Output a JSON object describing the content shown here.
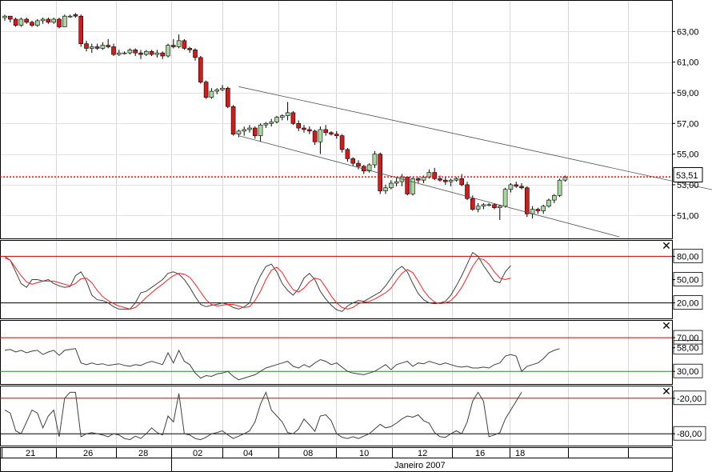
{
  "chart_data": [
    {
      "type": "candlestick",
      "panel": "price",
      "ylim": [
        49.5,
        65.0
      ],
      "y_ticks": [
        "63,00",
        "61,00",
        "59,00",
        "57,00",
        "55,00",
        "53,00",
        "51,00"
      ],
      "y_tick_values": [
        63,
        61,
        59,
        57,
        55,
        53,
        51
      ],
      "last_price": 53.51,
      "last_price_label": "53,51",
      "candles": [
        [
          63.9,
          64.1,
          63.7,
          64.0
        ],
        [
          64.0,
          64.0,
          63.6,
          63.8
        ],
        [
          63.8,
          63.9,
          63.3,
          63.4
        ],
        [
          63.4,
          63.9,
          63.3,
          63.8
        ],
        [
          63.8,
          63.9,
          63.5,
          63.6
        ],
        [
          63.6,
          63.7,
          63.3,
          63.4
        ],
        [
          63.4,
          63.8,
          63.3,
          63.7
        ],
        [
          63.7,
          63.9,
          63.5,
          63.8
        ],
        [
          63.8,
          63.9,
          63.5,
          63.6
        ],
        [
          63.6,
          63.9,
          63.5,
          63.8
        ],
        [
          63.8,
          63.9,
          63.2,
          63.3
        ],
        [
          63.3,
          64.1,
          63.3,
          64.0
        ],
        [
          64.0,
          64.1,
          63.9,
          64.0
        ],
        [
          64.1,
          64.2,
          63.9,
          64.0
        ],
        [
          64.0,
          64.1,
          62.0,
          62.2
        ],
        [
          62.2,
          62.4,
          61.7,
          61.9
        ],
        [
          61.9,
          62.2,
          61.6,
          62.0
        ],
        [
          62.0,
          62.2,
          61.8,
          61.9
        ],
        [
          61.9,
          62.3,
          61.8,
          62.1
        ],
        [
          62.1,
          62.5,
          61.9,
          62.0
        ],
        [
          62.0,
          62.2,
          61.4,
          61.5
        ],
        [
          61.5,
          61.8,
          61.4,
          61.6
        ],
        [
          61.6,
          61.7,
          61.5,
          61.6
        ],
        [
          61.6,
          61.9,
          61.5,
          61.8
        ],
        [
          61.8,
          61.9,
          61.4,
          61.6
        ],
        [
          61.6,
          61.8,
          61.2,
          61.5
        ],
        [
          61.5,
          61.8,
          61.4,
          61.7
        ],
        [
          61.7,
          61.8,
          61.4,
          61.5
        ],
        [
          61.5,
          61.8,
          61.3,
          61.6
        ],
        [
          61.6,
          61.7,
          61.2,
          61.4
        ],
        [
          61.4,
          62.2,
          61.3,
          62.1
        ],
        [
          62.1,
          62.5,
          61.9,
          62.0
        ],
        [
          62.0,
          62.8,
          61.9,
          62.4
        ],
        [
          62.4,
          62.5,
          61.8,
          61.9
        ],
        [
          61.9,
          62.0,
          61.6,
          61.8
        ],
        [
          61.8,
          61.9,
          61.1,
          61.3
        ],
        [
          61.3,
          61.4,
          59.6,
          59.7
        ],
        [
          59.7,
          59.8,
          58.6,
          58.7
        ],
        [
          58.7,
          59.3,
          58.6,
          59.1
        ],
        [
          59.1,
          59.3,
          58.9,
          59.2
        ],
        [
          59.2,
          59.5,
          59.1,
          59.3
        ],
        [
          59.3,
          59.4,
          58.0,
          58.1
        ],
        [
          58.1,
          58.2,
          56.2,
          56.3
        ],
        [
          56.3,
          56.6,
          56.1,
          56.5
        ],
        [
          56.5,
          56.8,
          56.2,
          56.6
        ],
        [
          56.6,
          56.9,
          56.4,
          56.7
        ],
        [
          56.7,
          56.8,
          56.0,
          56.2
        ],
        [
          56.2,
          57.0,
          55.8,
          56.9
        ],
        [
          56.9,
          57.1,
          56.7,
          57.0
        ],
        [
          57.0,
          57.3,
          56.8,
          57.1
        ],
        [
          57.1,
          57.5,
          57.0,
          57.4
        ],
        [
          57.4,
          57.6,
          57.2,
          57.5
        ],
        [
          57.5,
          58.4,
          57.2,
          57.7
        ],
        [
          57.7,
          57.8,
          56.9,
          57.0
        ],
        [
          57.0,
          57.2,
          56.5,
          56.7
        ],
        [
          56.7,
          56.9,
          56.4,
          56.6
        ],
        [
          56.6,
          56.8,
          56.3,
          56.5
        ],
        [
          56.5,
          56.6,
          55.6,
          55.8
        ],
        [
          55.8,
          56.8,
          55.0,
          56.6
        ],
        [
          56.6,
          56.9,
          56.2,
          56.4
        ],
        [
          56.4,
          56.5,
          56.2,
          56.3
        ],
        [
          56.3,
          56.5,
          56.0,
          56.2
        ],
        [
          56.2,
          56.3,
          55.1,
          55.3
        ],
        [
          55.3,
          55.4,
          54.5,
          54.7
        ],
        [
          54.7,
          54.8,
          54.2,
          54.4
        ],
        [
          54.4,
          54.6,
          54.0,
          54.2
        ],
        [
          54.2,
          54.3,
          53.7,
          53.9
        ],
        [
          53.9,
          54.4,
          53.8,
          54.3
        ],
        [
          54.3,
          55.2,
          54.1,
          55.0
        ],
        [
          55.0,
          55.1,
          52.4,
          52.6
        ],
        [
          52.6,
          53.0,
          52.4,
          52.8
        ],
        [
          52.8,
          53.3,
          52.7,
          53.1
        ],
        [
          53.1,
          53.5,
          52.9,
          53.2
        ],
        [
          53.2,
          53.7,
          52.9,
          53.5
        ],
        [
          53.5,
          53.5,
          52.3,
          52.4
        ],
        [
          52.4,
          53.5,
          52.3,
          53.4
        ],
        [
          53.4,
          53.5,
          53.1,
          53.3
        ],
        [
          53.3,
          53.6,
          53.1,
          53.5
        ],
        [
          53.5,
          54.0,
          53.4,
          53.8
        ],
        [
          53.8,
          54.1,
          53.3,
          53.4
        ],
        [
          53.4,
          53.6,
          53.2,
          53.3
        ],
        [
          53.3,
          53.5,
          53.0,
          53.2
        ],
        [
          53.2,
          53.4,
          52.9,
          53.3
        ],
        [
          53.3,
          53.5,
          53.2,
          53.4
        ],
        [
          53.4,
          53.7,
          52.9,
          53.0
        ],
        [
          53.0,
          53.2,
          52.0,
          52.1
        ],
        [
          52.1,
          52.3,
          51.3,
          51.4
        ],
        [
          51.4,
          51.8,
          51.2,
          51.6
        ],
        [
          51.6,
          51.8,
          51.4,
          51.7
        ],
        [
          51.7,
          51.8,
          51.6,
          51.7
        ],
        [
          51.7,
          51.8,
          51.4,
          51.5
        ],
        [
          51.5,
          51.7,
          50.7,
          51.6
        ],
        [
          51.6,
          52.8,
          51.5,
          52.7
        ],
        [
          52.7,
          53.1,
          52.5,
          53.0
        ],
        [
          53.0,
          53.2,
          52.8,
          52.9
        ],
        [
          52.9,
          53.1,
          52.7,
          52.8
        ],
        [
          52.8,
          52.9,
          50.9,
          51.1
        ],
        [
          51.1,
          51.6,
          50.8,
          51.4
        ],
        [
          51.4,
          51.5,
          51.1,
          51.3
        ],
        [
          51.3,
          51.7,
          51.1,
          51.6
        ],
        [
          51.6,
          52.1,
          51.5,
          52.0
        ],
        [
          52.0,
          52.4,
          51.8,
          52.3
        ],
        [
          52.3,
          53.4,
          52.2,
          53.3
        ],
        [
          53.3,
          53.6,
          53.2,
          53.5
        ]
      ],
      "trend_channel": [
        {
          "from": [
            43,
            59.4
          ],
          "to": [
            153,
            50.9
          ]
        },
        {
          "from": [
            43,
            56.2
          ],
          "to": [
            113,
            49.6
          ]
        }
      ]
    },
    {
      "type": "line",
      "panel": "stochastic",
      "ylim": [
        0,
        100
      ],
      "y_ticks": [
        "80,00",
        "50,00",
        "20,00"
      ],
      "y_tick_values": [
        80,
        50,
        20
      ],
      "levels": [
        80,
        20
      ],
      "series": [
        {
          "color": "#404040",
          "values": [
            80,
            75,
            60,
            45,
            40,
            50,
            50,
            48,
            50,
            45,
            42,
            40,
            41,
            55,
            60,
            48,
            30,
            24,
            23,
            20,
            15,
            12,
            12,
            12,
            20,
            33,
            35,
            40,
            45,
            50,
            58,
            60,
            57,
            50,
            40,
            28,
            18,
            15,
            17,
            18,
            20,
            18,
            14,
            12,
            15,
            20,
            40,
            55,
            67,
            70,
            60,
            45,
            36,
            30,
            38,
            52,
            58,
            50,
            35,
            25,
            17,
            11,
            9,
            16,
            20,
            23,
            22,
            26,
            30,
            34,
            42,
            52,
            62,
            67,
            60,
            45,
            32,
            24,
            20,
            19,
            20,
            22,
            30,
            42,
            55,
            70,
            85,
            80,
            68,
            58,
            48,
            46,
            60,
            68
          ]
        },
        {
          "color": "#ff2020",
          "values": [
            78,
            75,
            65,
            55,
            47,
            44,
            46,
            48,
            48,
            48,
            46,
            44,
            42,
            45,
            51,
            52,
            46,
            36,
            28,
            23,
            19,
            16,
            14,
            12,
            14,
            20,
            27,
            33,
            39,
            44,
            50,
            55,
            58,
            57,
            53,
            44,
            34,
            24,
            18,
            16,
            17,
            18,
            18,
            16,
            14,
            15,
            23,
            35,
            50,
            62,
            66,
            59,
            47,
            37,
            34,
            39,
            47,
            52,
            50,
            40,
            29,
            20,
            14,
            12,
            14,
            19,
            21,
            22,
            25,
            29,
            33,
            39,
            49,
            58,
            63,
            59,
            48,
            36,
            27,
            21,
            19,
            20,
            23,
            30,
            40,
            53,
            67,
            77,
            76,
            70,
            60,
            52,
            50,
            52
          ]
        }
      ]
    },
    {
      "type": "line",
      "panel": "rsi",
      "ylim": [
        15,
        90
      ],
      "y_ticks": [
        "70,00",
        "58,00",
        "30,00"
      ],
      "y_tick_values": [
        70,
        58,
        30
      ],
      "levels": [
        {
          "value": 70,
          "color": "#cc0000"
        },
        {
          "value": 30,
          "color": "#2a8a2a"
        }
      ],
      "series": [
        {
          "color": "#404040",
          "values": [
            55,
            56,
            53,
            55,
            52,
            54,
            55,
            50,
            53,
            55,
            49,
            55,
            56,
            57,
            40,
            38,
            40,
            38,
            39,
            37,
            38,
            39,
            37,
            36,
            38,
            37,
            40,
            42,
            40,
            38,
            52,
            40,
            55,
            42,
            38,
            28,
            22,
            25,
            24,
            27,
            28,
            30,
            24,
            20,
            22,
            24,
            26,
            30,
            34,
            36,
            38,
            40,
            42,
            36,
            34,
            38,
            35,
            40,
            44,
            42,
            38,
            40,
            35,
            30,
            28,
            27,
            26,
            28,
            30,
            34,
            38,
            32,
            38,
            40,
            42,
            36,
            40,
            39,
            42,
            40,
            38,
            40,
            38,
            36,
            35,
            36,
            34,
            34,
            35,
            34,
            38,
            40,
            48,
            50,
            48,
            30,
            36,
            38,
            40,
            45,
            52,
            55,
            57
          ]
        }
      ]
    },
    {
      "type": "line",
      "panel": "williams_r",
      "ylim": [
        -100,
        0
      ],
      "y_ticks": [
        "-20,00",
        "-80,00"
      ],
      "y_tick_values": [
        -20,
        -80
      ],
      "levels": [
        -20,
        -80
      ],
      "series": [
        {
          "color": "#404040",
          "values": [
            -40,
            -45,
            -75,
            -80,
            -60,
            -40,
            -45,
            -70,
            -50,
            -40,
            -85,
            -20,
            -10,
            -10,
            -85,
            -80,
            -78,
            -80,
            -82,
            -85,
            -80,
            -82,
            -88,
            -90,
            -84,
            -88,
            -80,
            -70,
            -78,
            -82,
            -50,
            -60,
            -12,
            -80,
            -82,
            -88,
            -90,
            -86,
            -80,
            -78,
            -75,
            -82,
            -88,
            -84,
            -80,
            -75,
            -60,
            -30,
            -10,
            -40,
            -50,
            -60,
            -78,
            -80,
            -72,
            -55,
            -65,
            -76,
            -50,
            -48,
            -58,
            -80,
            -86,
            -88,
            -85,
            -88,
            -84,
            -80,
            -72,
            -64,
            -70,
            -68,
            -62,
            -55,
            -50,
            -52,
            -48,
            -58,
            -62,
            -78,
            -85,
            -86,
            -80,
            -75,
            -80,
            -60,
            -25,
            -10,
            -25,
            -85,
            -82,
            -78,
            -55,
            -40,
            -25,
            -10
          ]
        }
      ]
    }
  ],
  "price_panel": {
    "last_price_label": "53,51"
  },
  "stochastic_panel": {
    "tick_labels": [
      "80,00",
      "50,00",
      "20,00"
    ]
  },
  "rsi_panel": {
    "tick_labels": [
      "70,00",
      "58,00",
      "30,00"
    ]
  },
  "williams_panel": {
    "tick_labels": [
      "-20,00",
      "-80,00"
    ]
  },
  "x_axis": {
    "date_ticks": [
      "21",
      "26",
      "28",
      "02",
      "04",
      "08",
      "10",
      "12",
      "16",
      "18"
    ],
    "month_label": "Janeiro 2007"
  },
  "close_glyph": "✕",
  "colors": {
    "bull_candle": "#a8d8a0",
    "bear_candle": "#d41a1a",
    "price_line": "#ff0000",
    "stoch_fast": "#404040",
    "stoch_slow": "#ff2020",
    "rsi_low_level": "#2a8a2a"
  }
}
